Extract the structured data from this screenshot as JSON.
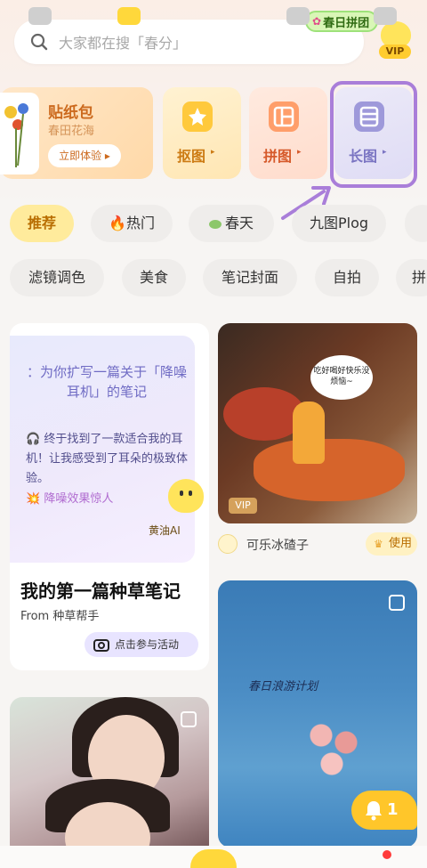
{
  "search": {
    "placeholder": "大家都在搜「春分」"
  },
  "promo": {
    "label": "春日拼团"
  },
  "vip": {
    "label": "VIP"
  },
  "tools": {
    "sticker": {
      "title": "贴纸包",
      "subtitle": "春田花海",
      "button": "立即体验 ▸"
    },
    "cutout": {
      "label": "抠图"
    },
    "collage": {
      "label": "拼图"
    },
    "long_image": {
      "label": "长图"
    },
    "arrow": "▸"
  },
  "categories_row1": [
    {
      "label": "推荐",
      "active": true
    },
    {
      "label": "🔥热门",
      "active": false
    },
    {
      "label": "春天",
      "active": false
    },
    {
      "label": "九图Plog",
      "active": false
    }
  ],
  "categories_row2": [
    {
      "label": "滤镜调色"
    },
    {
      "label": "美食"
    },
    {
      "label": "笔记封面"
    },
    {
      "label": "自拍"
    },
    {
      "label": "拼"
    }
  ],
  "feed": {
    "note_card": {
      "prompt": "：为你扩写一篇关于「降噪耳机」的笔记",
      "body": "🎧 终于找到了一款适合我的耳机！让我感受到了耳朵的极致体验。",
      "tag": "💥 降噪效果惊人",
      "ai_name": "黄油AI",
      "title": "我的第一篇种草笔记",
      "from": "From 种草帮手",
      "button": "点击参与活动"
    },
    "food_card": {
      "bubble": "吃好喝好快乐没烦恼~",
      "badge": "VIP",
      "author": "可乐冰碴子",
      "use_button": "使用"
    },
    "flowers_card": {
      "caption": "春日浪游计划"
    }
  },
  "notification": {
    "count": "1"
  }
}
